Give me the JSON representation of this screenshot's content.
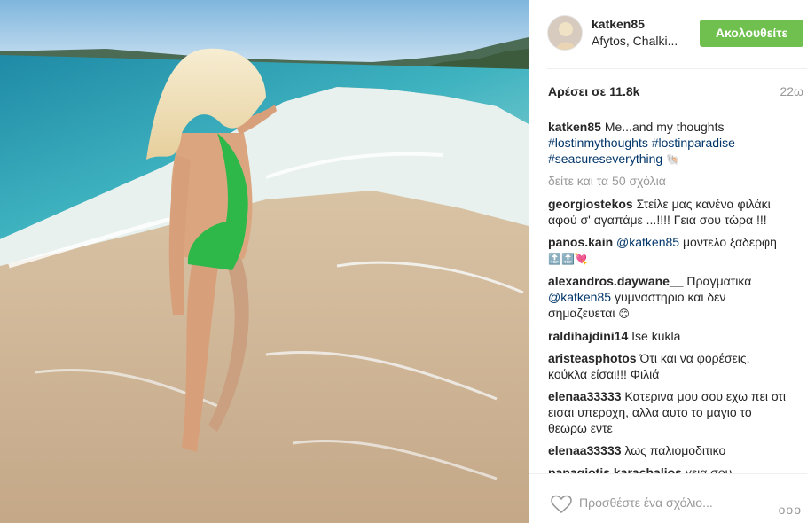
{
  "post": {
    "photo": {
      "description_icon": "beach-photo"
    },
    "header": {
      "username": "katken85",
      "location": "Afytos, Chalki...",
      "follow_label": "Ακολουθείτε"
    },
    "likes": "Αρέσει σε 11.8k",
    "time_ago": "22ω",
    "caption": {
      "user": "katken85",
      "text": "Me...and my thoughts",
      "tags": [
        "#lostinmythoughts",
        "#lostinparadise",
        "#seacureseverything"
      ],
      "emoji": "🐚"
    },
    "more_comments": "δείτε και τα 50 σχόλια",
    "comments": [
      {
        "user": "georgiostekos",
        "text": "Στείλε μας κανένα φιλάκι αφού σ' αγαπάμε ...!!!! Γεια σου τώρα !!!",
        "mention": "",
        "emoji": ""
      },
      {
        "user": "panos.kain",
        "mention": "@katken85",
        "text": "μοντελο ξαδερφη",
        "emoji": "🔝🔝💘"
      },
      {
        "user": "alexandros.daywane__",
        "text": "Πραγματικα",
        "mention": "@katken85",
        "text2": "γυμναστηριο και δεν σημαζευεται",
        "emoji": "😊"
      },
      {
        "user": "raldihajdini14",
        "text": "Ise kukla",
        "mention": "",
        "emoji": ""
      },
      {
        "user": "aristeasphotos",
        "text": "Ότι και να φορέσεις, κούκλα είσαι!!! Φιλιά",
        "mention": "",
        "emoji": ""
      },
      {
        "user": "elenaa33333",
        "text": "Κατερινα μου σου εχω πει οτι εισαι υπεροχη, αλλα αυτο το μαγιο το θεωρω εντε",
        "mention": "",
        "emoji": ""
      },
      {
        "user": "elenaa33333",
        "text": "λως παλιομοδιτικο",
        "mention": "",
        "emoji": ""
      },
      {
        "user": "panagiotis.karachalios",
        "text": "γεια σου",
        "mention": "",
        "emoji": ""
      }
    ],
    "comment_bar": {
      "placeholder": "Προσθέστε ένα σχόλιο...",
      "more": "ooo"
    },
    "colors": {
      "follow_button": "#70c050",
      "link": "#003569",
      "muted": "#999999"
    }
  }
}
